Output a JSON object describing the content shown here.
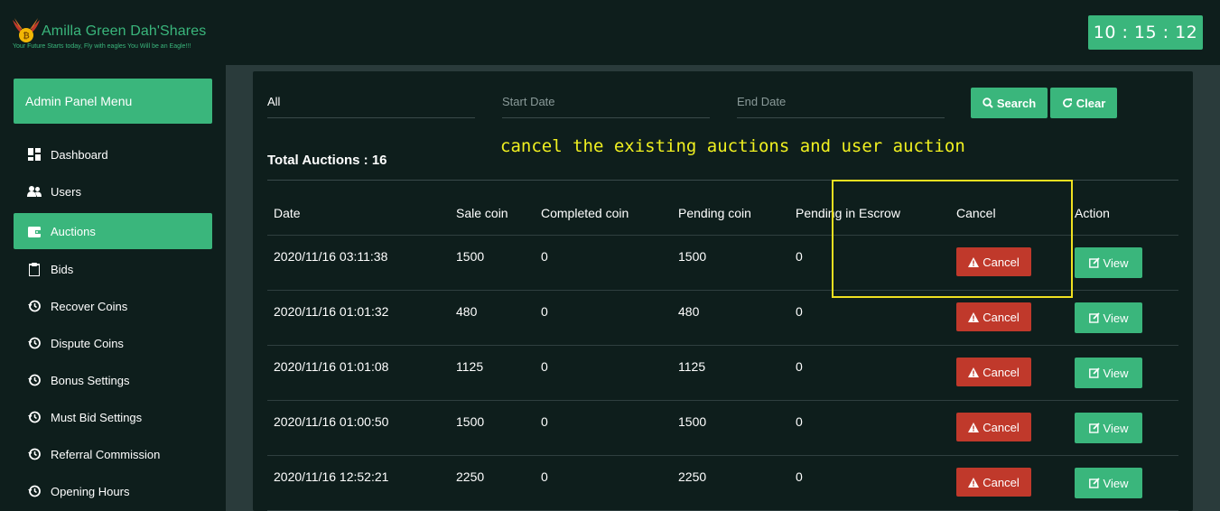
{
  "header": {
    "brand": "Amilla Green Dah'Shares",
    "tagline": "Your Future Starts today, Fly with eagles You Will be an Eagle!!!",
    "clock": "10 : 15 : 12"
  },
  "sidebar": {
    "title": "Admin Panel Menu",
    "items": [
      {
        "label": "Dashboard",
        "icon": "dashboard-icon"
      },
      {
        "label": "Users",
        "icon": "users-icon"
      },
      {
        "label": "Auctions",
        "icon": "wallet-icon",
        "active": true
      },
      {
        "label": "Bids",
        "icon": "clipboard-icon"
      },
      {
        "label": "Recover Coins",
        "icon": "history-icon"
      },
      {
        "label": "Dispute Coins",
        "icon": "history-icon"
      },
      {
        "label": "Bonus Settings",
        "icon": "history-icon"
      },
      {
        "label": "Must Bid Settings",
        "icon": "history-icon"
      },
      {
        "label": "Referral Commission",
        "icon": "history-icon"
      },
      {
        "label": "Opening Hours",
        "icon": "history-icon"
      }
    ]
  },
  "filters": {
    "status_value": "All",
    "start_placeholder": "Start Date",
    "end_placeholder": "End Date",
    "search_label": "Search",
    "clear_label": "Clear"
  },
  "annotation": "cancel the existing auctions and user auction",
  "total_auctions": "Total Auctions : 16",
  "table": {
    "headers": [
      "Date",
      "Sale coin",
      "Completed coin",
      "Pending coin",
      "Pending in Escrow",
      "Cancel",
      "Action"
    ],
    "cancel_label": "Cancel",
    "view_label": "View",
    "rows": [
      {
        "date": "2020/11/16 03:11:38",
        "sale": "1500",
        "completed": "0",
        "pending": "1500",
        "escrow": "0"
      },
      {
        "date": "2020/11/16 01:01:32",
        "sale": "480",
        "completed": "0",
        "pending": "480",
        "escrow": "0"
      },
      {
        "date": "2020/11/16 01:01:08",
        "sale": "1125",
        "completed": "0",
        "pending": "1125",
        "escrow": "0"
      },
      {
        "date": "2020/11/16 01:00:50",
        "sale": "1500",
        "completed": "0",
        "pending": "1500",
        "escrow": "0"
      },
      {
        "date": "2020/11/16 12:52:21",
        "sale": "2250",
        "completed": "0",
        "pending": "2250",
        "escrow": "0"
      }
    ]
  },
  "colors": {
    "accent": "#3ab67c",
    "danger": "#c0392b",
    "background": "#0e1e1c",
    "annotation": "#f0f020"
  }
}
